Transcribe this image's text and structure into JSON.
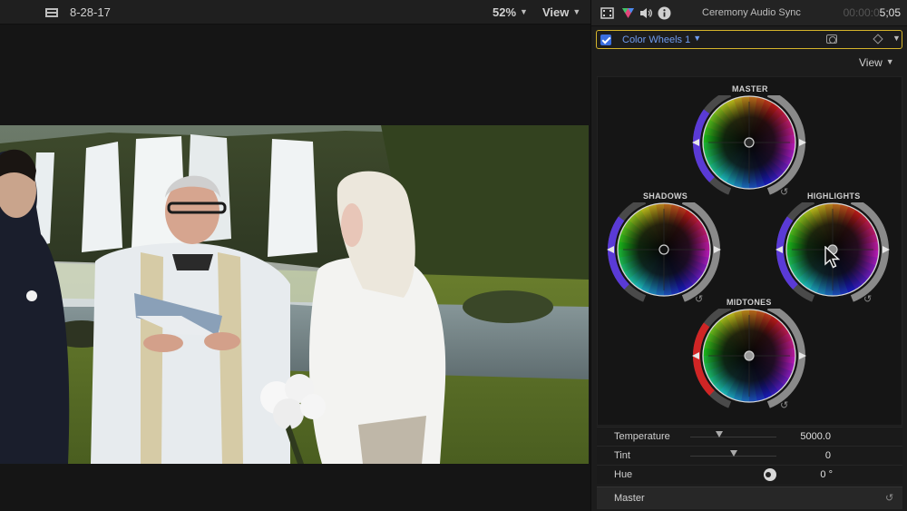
{
  "viewer": {
    "clip_title": "8-28-17",
    "zoom": "52%",
    "view_label": "View"
  },
  "inspector": {
    "title": "Ceremony Audio Sync",
    "timecode_dim": "00:00:0",
    "timecode": "5;05",
    "tabs": [
      "video-inspector",
      "color-inspector",
      "audio-inspector",
      "info-inspector"
    ],
    "effect": {
      "name": "Color Wheels 1",
      "enabled": true
    },
    "view_label": "View"
  },
  "wheels": {
    "master": "MASTER",
    "shadows": "SHADOWS",
    "highlights": "HIGHLIGHTS",
    "midtones": "MIDTONES"
  },
  "params": {
    "temperature": {
      "label": "Temperature",
      "value": "5000.0",
      "slider_position": 0.34
    },
    "tint": {
      "label": "Tint",
      "value": "0",
      "slider_position": 0.5
    },
    "hue": {
      "label": "Hue",
      "value": "0 °"
    }
  },
  "master_section": {
    "label": "Master"
  },
  "colors": {
    "accent_yellow": "#d5b52b",
    "accent_blue": "#6f9cf0",
    "checkbox_blue": "#3a6fe0"
  }
}
